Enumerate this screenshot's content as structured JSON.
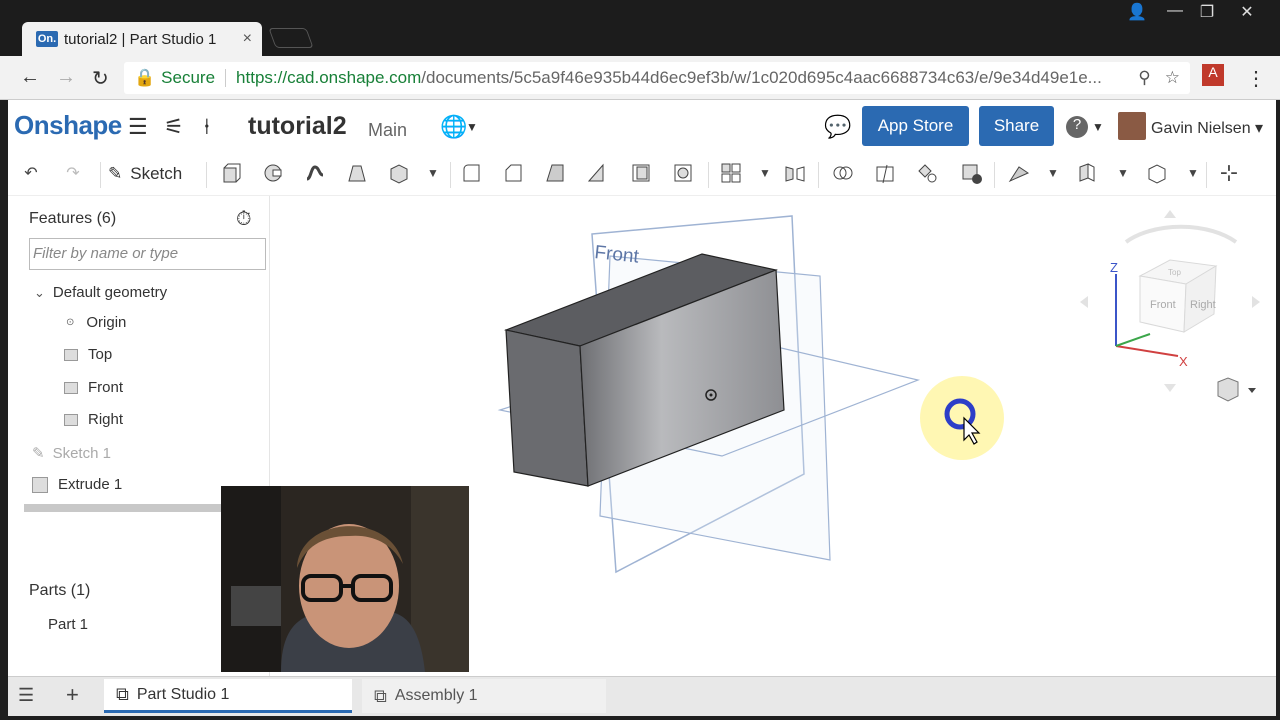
{
  "browser": {
    "tab_title": "tutorial2 | Part Studio 1",
    "tab_favicon": "On.",
    "secure_label": "Secure",
    "url_main": "https://cad.onshape.com",
    "url_path": "/documents/5c5a9f46e935b44d6ec9ef3b/w/1c020d695c4aac6688734c63/e/9e34d49e1e..."
  },
  "header": {
    "logo": "Onshape",
    "doc_title": "tutorial2",
    "doc_branch": "Main",
    "app_store": "App Store",
    "share": "Share",
    "user": "Gavin Nielsen"
  },
  "toolbar": {
    "sketch_label": "Sketch"
  },
  "features": {
    "title": "Features (6)",
    "filter_placeholder": "Filter by name or type",
    "default_geometry": "Default geometry",
    "items": [
      "Origin",
      "Top",
      "Front",
      "Right",
      "Sketch 1",
      "Extrude 1"
    ]
  },
  "parts": {
    "title": "Parts (1)",
    "items": [
      "Part 1"
    ]
  },
  "viewport": {
    "plane_label": "Front",
    "cube_front": "Front",
    "cube_right": "Right",
    "cube_top": "Top",
    "axis_z": "Z",
    "axis_x": "X"
  },
  "bottom_tabs": [
    "Part Studio 1",
    "Assembly 1"
  ],
  "colors": {
    "brand": "#2b6ab2",
    "plane": "#8fa9cf"
  }
}
